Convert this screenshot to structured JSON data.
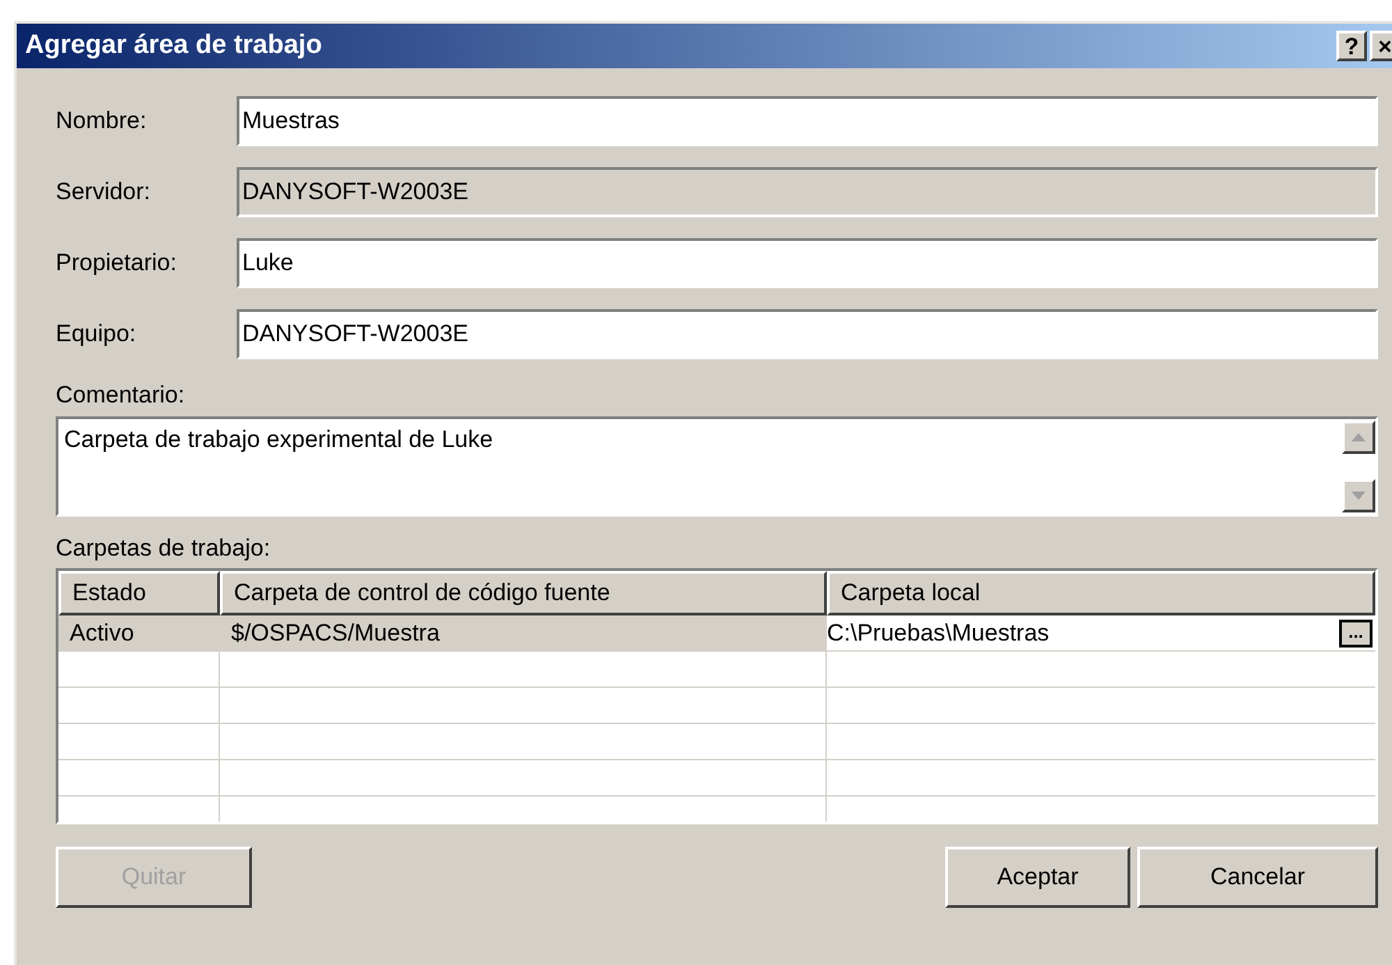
{
  "window": {
    "title": "Agregar área de trabajo",
    "title_buttons": [
      "?",
      "×"
    ]
  },
  "fields": [
    {
      "label": "Nombre:",
      "value": "Muestras",
      "disabled": false
    },
    {
      "label": "Servidor:",
      "value": "DANYSOFT-W2003E",
      "disabled": true
    },
    {
      "label": "Propietario:",
      "value": "Luke",
      "disabled": false
    },
    {
      "label": "Equipo:",
      "value": "DANYSOFT-W2003E",
      "disabled": false
    }
  ],
  "comment": {
    "label": "Comentario:",
    "value": "Carpeta de trabajo experimental de Luke"
  },
  "folders": {
    "label": "Carpetas de trabajo:",
    "columns": [
      "Estado",
      "Carpeta de control de código fuente",
      "Carpeta local"
    ],
    "rows": [
      {
        "cells": [
          "Activo",
          "$/OSPACS/Muestra",
          "C:\\Pruebas\\Muestras"
        ],
        "selected": true,
        "browse": "..."
      }
    ]
  },
  "buttons": [
    {
      "label": "Quitar",
      "disabled": true
    },
    {
      "label": "Aceptar",
      "disabled": false
    },
    {
      "label": "Cancelar",
      "disabled": false
    }
  ]
}
